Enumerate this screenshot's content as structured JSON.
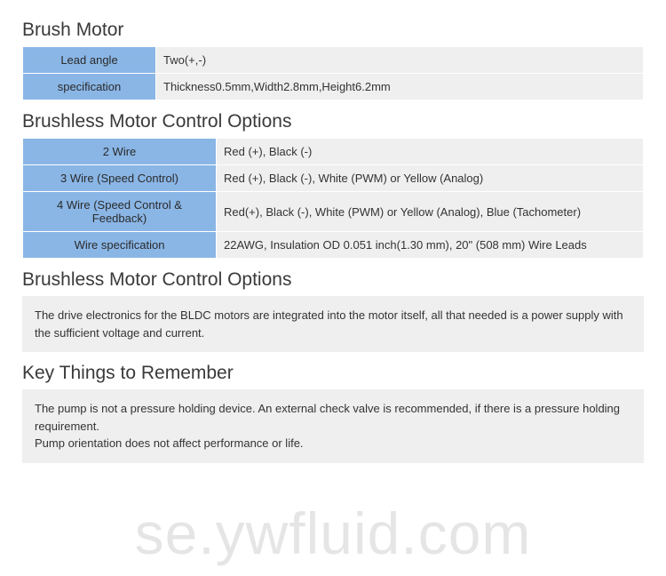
{
  "section1": {
    "title": "Brush Motor",
    "rows": [
      {
        "label": "Lead angle",
        "value": "Two(+,-)"
      },
      {
        "label": "specification",
        "value": "Thickness0.5mm,Width2.8mm,Height6.2mm"
      }
    ]
  },
  "section2": {
    "title": "Brushless Motor Control Options",
    "rows": [
      {
        "label": "2 Wire",
        "value": "Red (+), Black (-)"
      },
      {
        "label": "3 Wire (Speed Control)",
        "value": "Red (+), Black (-), White (PWM) or Yellow (Analog)"
      },
      {
        "label": "4 Wire (Speed Control & Feedback)",
        "value": "Red(+), Black (-), White (PWM) or Yellow (Analog), Blue (Tachometer)"
      },
      {
        "label": "Wire specification",
        "value": "22AWG, Insulation OD 0.051 inch(1.30 mm), 20\" (508 mm) Wire Leads"
      }
    ]
  },
  "section3": {
    "title": "Brushless Motor Control Options",
    "text": "The drive electronics for the BLDC motors are integrated into the motor itself, all that needed is a power supply with the sufficient voltage and current."
  },
  "section4": {
    "title": "Key Things to Remember",
    "line1": "The pump is not a pressure holding device. An external check valve is recommended, if there is a pressure holding requirement.",
    "line2": "Pump orientation does not affect performance or life."
  },
  "watermark": "se.ywfluid.com"
}
